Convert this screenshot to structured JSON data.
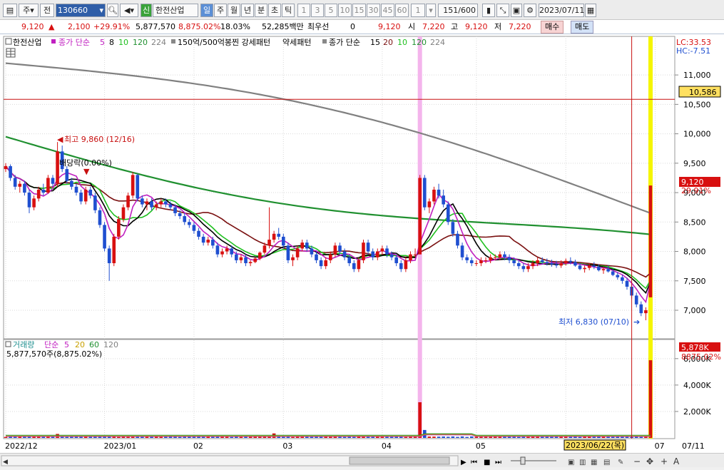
{
  "toolbar": {
    "market": "주",
    "kind": "전",
    "code": "130660",
    "new_badge": "신",
    "stock_name": "한전산업",
    "periods": [
      "일",
      "주",
      "월",
      "년",
      "분",
      "초",
      "틱"
    ],
    "numbers": [
      "1",
      "3",
      "5",
      "10",
      "15",
      "30",
      "45",
      "60"
    ],
    "unit_value": "1",
    "count": "151",
    "count_total": "/600",
    "date": "2023/07/11"
  },
  "quote": {
    "price": "9,120",
    "change": "2,100",
    "change_pct": "+29.91%",
    "volume": "5,877,570",
    "volume_ratio": "8,875.02%",
    "turnover": "18.03%",
    "amount": "52,285백만",
    "best_label": "최우선",
    "best_value": "0",
    "best_price": "9,120",
    "open_label": "시",
    "open": "7,220",
    "high_label": "고",
    "high": "9,120",
    "low_label": "저",
    "low": "7,220",
    "buy": "매수",
    "sell": "매도"
  },
  "legend": {
    "name": "한전산업",
    "ma_label": "종가 단순",
    "ma_periods": [
      "5",
      "8",
      "10",
      "120",
      "224"
    ],
    "pattern_label": "150억/500억봉찐 강세패턴",
    "weak_label": "약세패턴",
    "ma2_label": "종가 단순",
    "ma2_periods": [
      "15",
      "20",
      "10",
      "120",
      "224"
    ],
    "lc": "LC:33.53",
    "hc": "HC:-7.51"
  },
  "annotations": {
    "high": "최고 9,860 (12/16)",
    "dividend": "배당락(0.00%)",
    "low": "최저 6,830 (07/10)",
    "price_tag": "9,120",
    "pct_tag": "29.91%",
    "crosshair_tag": "10,586",
    "date_tag": "2023/06/22(목)"
  },
  "volume_legend": {
    "label": "거래량",
    "ma_label": "단순",
    "periods": [
      "5",
      "20",
      "60",
      "120"
    ],
    "value": "5,877,570주(8,875.02%)",
    "tag_value": "5,878K",
    "tag_pct": "8875.02%"
  },
  "colors": {
    "up": "#d81010",
    "down": "#1f4fd0",
    "ma5": "#c020c0",
    "ma8": "#000000",
    "ma10": "#20c020",
    "ma120": "#209030",
    "ma224": "#808080",
    "ma20": "#7a1010",
    "highlight_pink": "#f4b4ec",
    "highlight_yellow": "#f5f500",
    "crosshair": "#c81010"
  },
  "chart_data": [
    {
      "type": "candlestick",
      "yticks": [
        7000,
        7500,
        8000,
        8500,
        9000,
        9500,
        10000,
        10500,
        11000
      ],
      "ytick_labels": [
        "7,000",
        "7,500",
        "8,000",
        "8,500",
        "9,000",
        "9,500",
        "10,000",
        "10,500",
        "11,000"
      ],
      "ylim": [
        6600,
        11450
      ],
      "xticks": [
        "2022/12",
        "2023/01",
        "02",
        "03",
        "04",
        "05",
        "06",
        "07",
        "07/11"
      ],
      "xtick_positions": [
        0,
        21,
        40,
        59,
        80,
        100,
        119,
        138,
        150
      ],
      "ohlc": [
        [
          9400,
          9500,
          9350,
          9450
        ],
        [
          9450,
          9480,
          9200,
          9250
        ],
        [
          9250,
          9300,
          9050,
          9100
        ],
        [
          9100,
          9200,
          9000,
          9150
        ],
        [
          9150,
          9200,
          8950,
          9000
        ],
        [
          9000,
          9050,
          8650,
          8750
        ],
        [
          8750,
          8950,
          8700,
          8900
        ],
        [
          8900,
          9100,
          8850,
          9050
        ],
        [
          9050,
          9150,
          8950,
          9000
        ],
        [
          9000,
          9300,
          8980,
          9250
        ],
        [
          9250,
          9300,
          9100,
          9150
        ],
        [
          9150,
          9860,
          9100,
          9700
        ],
        [
          9700,
          9800,
          9350,
          9400
        ],
        [
          9400,
          9450,
          9150,
          9200
        ],
        [
          9200,
          9250,
          9050,
          9100
        ],
        [
          9100,
          9150,
          8950,
          9000
        ],
        [
          9000,
          9050,
          8800,
          8850
        ],
        [
          8850,
          9100,
          8800,
          9050
        ],
        [
          9050,
          9100,
          8900,
          8950
        ],
        [
          8950,
          9000,
          8650,
          8700
        ],
        [
          8700,
          8750,
          8400,
          8450
        ],
        [
          8450,
          8500,
          8000,
          8050
        ],
        [
          8050,
          8100,
          7500,
          7800
        ],
        [
          7800,
          8300,
          7750,
          8250
        ],
        [
          8250,
          8600,
          8200,
          8550
        ],
        [
          8550,
          8800,
          8500,
          8750
        ],
        [
          8750,
          9000,
          8700,
          8950
        ],
        [
          8950,
          9350,
          8900,
          9300
        ],
        [
          9300,
          9320,
          8850,
          8900
        ],
        [
          8900,
          8950,
          8750,
          8800
        ],
        [
          8800,
          8900,
          8700,
          8850
        ],
        [
          8850,
          8900,
          8700,
          8750
        ],
        [
          8750,
          8850,
          8700,
          8800
        ],
        [
          8800,
          8900,
          8750,
          8850
        ],
        [
          8850,
          8900,
          8750,
          8800
        ],
        [
          8800,
          8850,
          8700,
          8750
        ],
        [
          8750,
          8800,
          8600,
          8650
        ],
        [
          8650,
          8700,
          8550,
          8600
        ],
        [
          8600,
          8650,
          8450,
          8500
        ],
        [
          8500,
          8550,
          8400,
          8450
        ],
        [
          8450,
          8500,
          8300,
          8350
        ],
        [
          8350,
          8400,
          8200,
          8250
        ],
        [
          8250,
          8300,
          8100,
          8150
        ],
        [
          8150,
          8250,
          8100,
          8200
        ],
        [
          8200,
          8250,
          8050,
          8100
        ],
        [
          8100,
          8150,
          7900,
          7950
        ],
        [
          7950,
          8050,
          7900,
          8000
        ],
        [
          8000,
          8100,
          7950,
          8050
        ],
        [
          8050,
          8100,
          7900,
          7950
        ],
        [
          7950,
          8000,
          7800,
          7850
        ],
        [
          7850,
          7950,
          7800,
          7900
        ],
        [
          7900,
          7950,
          7750,
          7800
        ],
        [
          7800,
          7850,
          7750,
          7820
        ],
        [
          7820,
          7900,
          7800,
          7880
        ],
        [
          7880,
          8000,
          7850,
          7980
        ],
        [
          7980,
          8150,
          7950,
          8100
        ],
        [
          8100,
          8750,
          8050,
          8200
        ],
        [
          8200,
          8350,
          8150,
          8300
        ],
        [
          8300,
          8400,
          8200,
          8250
        ],
        [
          8250,
          8300,
          8050,
          8100
        ],
        [
          8100,
          8150,
          7800,
          7850
        ],
        [
          7850,
          7950,
          7750,
          7900
        ],
        [
          7900,
          8100,
          7850,
          8050
        ],
        [
          8050,
          8200,
          8000,
          8150
        ],
        [
          8150,
          8200,
          8000,
          8050
        ],
        [
          8050,
          8100,
          7900,
          7950
        ],
        [
          7950,
          8000,
          7800,
          7850
        ],
        [
          7850,
          7900,
          7700,
          7750
        ],
        [
          7750,
          7900,
          7700,
          7850
        ],
        [
          7850,
          8000,
          7800,
          7950
        ],
        [
          7950,
          8150,
          7900,
          8100
        ],
        [
          8100,
          8150,
          7950,
          8000
        ],
        [
          8000,
          8050,
          7850,
          7900
        ],
        [
          7900,
          7950,
          7750,
          7800
        ],
        [
          7800,
          7850,
          7650,
          7700
        ],
        [
          7700,
          7900,
          7650,
          7850
        ],
        [
          7850,
          8200,
          7800,
          8150
        ],
        [
          8150,
          8200,
          7950,
          8000
        ],
        [
          8000,
          8050,
          7850,
          7900
        ],
        [
          7900,
          8050,
          7850,
          8000
        ],
        [
          8000,
          8100,
          7950,
          8050
        ],
        [
          8050,
          8100,
          7900,
          7950
        ],
        [
          7950,
          8000,
          7850,
          7900
        ],
        [
          7900,
          7950,
          7750,
          7800
        ],
        [
          7800,
          7850,
          7650,
          7700
        ],
        [
          7700,
          7900,
          7650,
          7850
        ],
        [
          7850,
          8000,
          7800,
          7950
        ],
        [
          7950,
          8050,
          7900,
          7950
        ],
        [
          7950,
          9300,
          7950,
          9250
        ],
        [
          9250,
          9300,
          8700,
          8750
        ],
        [
          8750,
          8900,
          8650,
          8850
        ],
        [
          8850,
          9100,
          8800,
          9050
        ],
        [
          9050,
          9150,
          8900,
          8950
        ],
        [
          8950,
          9050,
          8750,
          8800
        ],
        [
          8800,
          8850,
          8450,
          8500
        ],
        [
          8500,
          8550,
          8250,
          8300
        ],
        [
          8300,
          8350,
          8050,
          8100
        ],
        [
          8100,
          8150,
          7850,
          7900
        ],
        [
          7900,
          7950,
          7800,
          7850
        ],
        [
          7850,
          7900,
          7750,
          7800
        ],
        [
          7800,
          7850,
          7750,
          7800
        ],
        [
          7800,
          7900,
          7750,
          7850
        ],
        [
          7850,
          7900,
          7800,
          7850
        ],
        [
          7850,
          7950,
          7800,
          7900
        ],
        [
          7900,
          7950,
          7850,
          7900
        ],
        [
          7900,
          8000,
          7850,
          7950
        ],
        [
          7950,
          8000,
          7850,
          7900
        ],
        [
          7900,
          7950,
          7800,
          7850
        ],
        [
          7850,
          7900,
          7750,
          7800
        ],
        [
          7800,
          7850,
          7700,
          7750
        ],
        [
          7750,
          7800,
          7650,
          7700
        ],
        [
          7700,
          7800,
          7650,
          7750
        ],
        [
          7750,
          7850,
          7700,
          7800
        ],
        [
          7800,
          7900,
          7750,
          7850
        ],
        [
          7850,
          7900,
          7780,
          7820
        ],
        [
          7820,
          7880,
          7760,
          7800
        ],
        [
          7800,
          7860,
          7740,
          7780
        ],
        [
          7780,
          7840,
          7720,
          7760
        ],
        [
          7760,
          7850,
          7720,
          7800
        ],
        [
          7800,
          7880,
          7760,
          7840
        ],
        [
          7840,
          7900,
          7780,
          7820
        ],
        [
          7820,
          7860,
          7740,
          7760
        ],
        [
          7760,
          7800,
          7680,
          7700
        ],
        [
          7700,
          7760,
          7640,
          7720
        ],
        [
          7720,
          7800,
          7680,
          7760
        ],
        [
          7760,
          7820,
          7700,
          7740
        ],
        [
          7740,
          7780,
          7660,
          7680
        ],
        [
          7680,
          7740,
          7620,
          7700
        ],
        [
          7700,
          7760,
          7640,
          7660
        ],
        [
          7660,
          7700,
          7580,
          7600
        ],
        [
          7600,
          7650,
          7520,
          7560
        ],
        [
          7560,
          7600,
          7450,
          7500
        ],
        [
          7500,
          7550,
          7350,
          7400
        ],
        [
          7400,
          7450,
          7200,
          7250
        ],
        [
          7250,
          7300,
          7050,
          7100
        ],
        [
          7100,
          7150,
          6900,
          6950
        ],
        [
          6950,
          7050,
          6830,
          7000
        ],
        [
          7220,
          9120,
          7220,
          9120
        ]
      ],
      "ma_series": [
        {
          "name": "5",
          "color": "#c020c0"
        },
        {
          "name": "8",
          "color": "#000000"
        },
        {
          "name": "10",
          "color": "#20c020"
        },
        {
          "name": "120",
          "color": "#209030"
        },
        {
          "name": "224",
          "color": "#808080"
        }
      ]
    },
    {
      "type": "bar",
      "yticks": [
        2000,
        4000,
        6000
      ],
      "ytick_labels": [
        "2,000K",
        "4,000K",
        "6,000K"
      ],
      "ylim": [
        0,
        6800
      ]
    }
  ]
}
